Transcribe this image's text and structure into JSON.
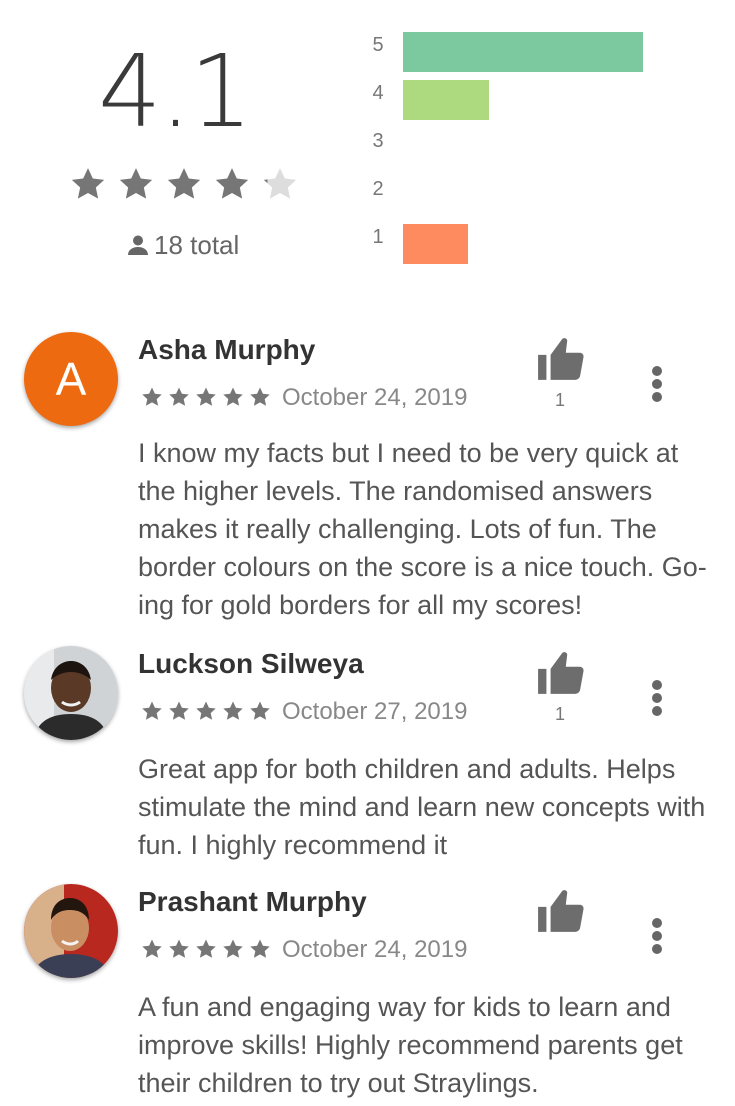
{
  "summary": {
    "average": "4.1",
    "average_stars": 4.1,
    "total_label": "18 total",
    "histogram": [
      {
        "star": "5",
        "fraction": 1.0,
        "color": "#7cc89f"
      },
      {
        "star": "4",
        "fraction": 0.36,
        "color": "#add97f"
      },
      {
        "star": "3",
        "fraction": 0.0,
        "color": "#f0d060"
      },
      {
        "star": "2",
        "fraction": 0.0,
        "color": "#f8b35a"
      },
      {
        "star": "1",
        "fraction": 0.27,
        "color": "#fe8b60"
      }
    ]
  },
  "reviews": [
    {
      "name": "Asha Murphy",
      "avatar": {
        "type": "letter",
        "letter": "A",
        "color": "#ee6a10"
      },
      "rating": 5,
      "date": "October 24, 2019",
      "helpful_count": "1",
      "text": "I know my facts but I need to be very quick at the higher levels. The randomised answers makes it really challenging. Lots of fun. The border colours on the score is a nice touch. Go-ing for gold borders for all my scores!"
    },
    {
      "name": "Luckson Silweya",
      "avatar": {
        "type": "photo",
        "icon": "person-photo"
      },
      "rating": 5,
      "date": "October 27, 2019",
      "helpful_count": "1",
      "text": "Great app for both children and adults. Helps stimulate the mind and learn new concepts with fun. I highly recommend it"
    },
    {
      "name": "Prashant Murphy",
      "avatar": {
        "type": "photo",
        "icon": "person-photo"
      },
      "rating": 5,
      "date": "October 24, 2019",
      "helpful_count": "",
      "text": "A fun and engaging way for kids to learn and improve skills! Highly recommend parents get their children to try out Straylings."
    }
  ],
  "icons": {
    "star": "star-icon",
    "user": "user-icon",
    "thumb": "thumbs-up-icon",
    "more": "more-vertical-icon"
  },
  "colors": {
    "star_filled": "#767676",
    "star_empty": "#dddddd"
  }
}
